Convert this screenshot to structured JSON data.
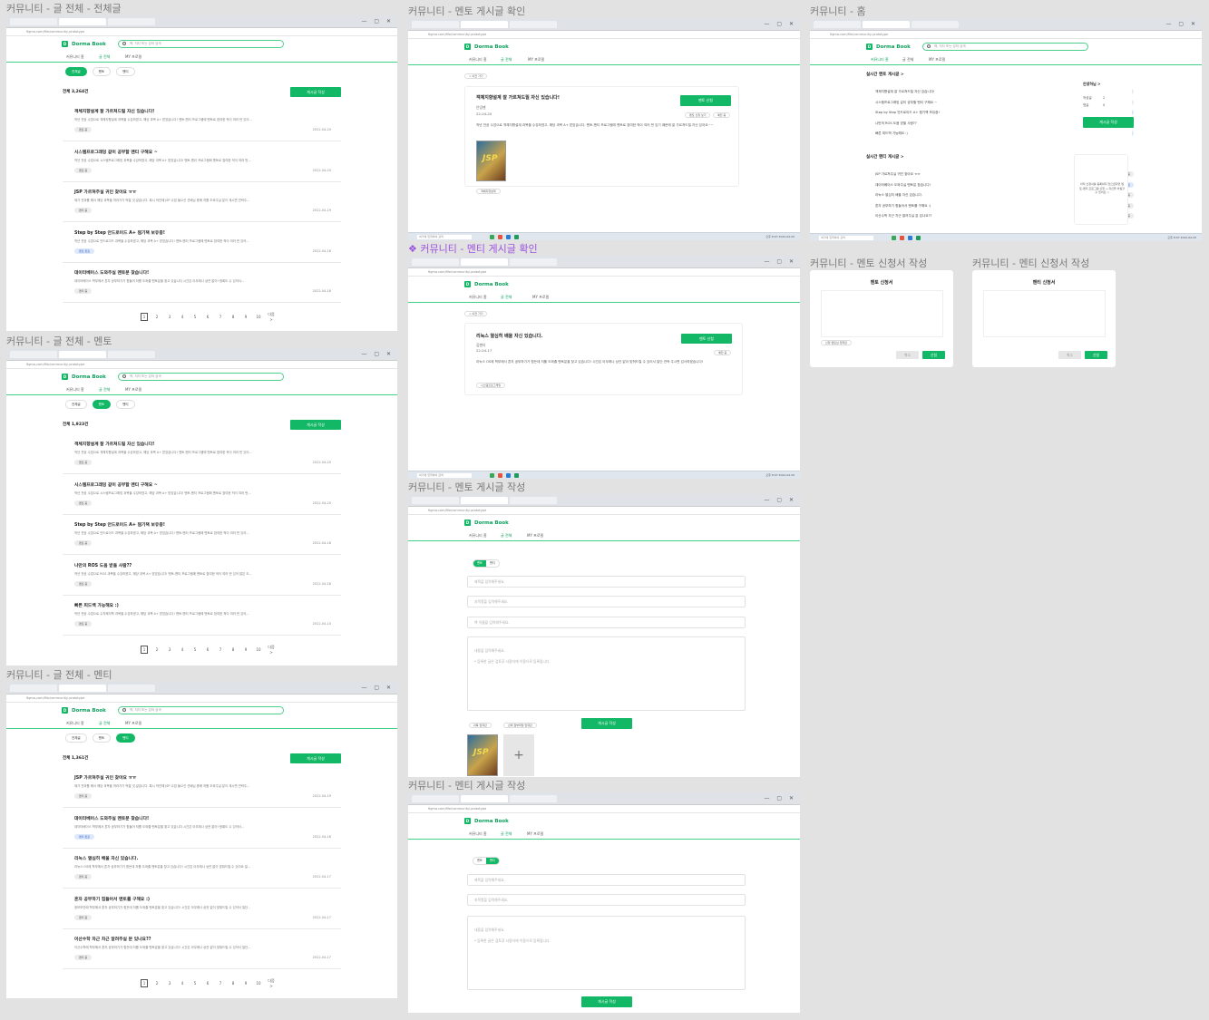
{
  "brand": "Dorma Book",
  "browser_tab": "커뮤니티 - Figma",
  "address": "figma.com/file/community-prototype",
  "nav": [
    "커뮤니티 홈",
    "글 전체",
    "MY 프로필"
  ],
  "search_placeholder": "책, 저자 또는 강좌 검색",
  "filters": [
    "전체글",
    "멘토",
    "멘티"
  ],
  "write_label": "게시글 작성",
  "next_label": "다음 >",
  "pages": [
    "1",
    "2",
    "3",
    "4",
    "5",
    "6",
    "7",
    "8",
    "9",
    "10"
  ],
  "taskbar_search": "여기에 입력하여 검색",
  "taskbar_time": "오후 8:07 2022-04-20",
  "frames": {
    "all": {
      "title": "커뮤니티 - 글 전체 - 전체글",
      "count": "전체 3,264건",
      "posts": [
        {
          "title": "객체지향설계 잘 가르쳐드릴 자신 있습니다!",
          "desc": "작년 전공 수업으로 객체지향설계 과목을 수강하였고, 해당 과목 A+ 받았습니다! 멘토-멘티 프로그램에 멘토로 참여한 적이 여러 번 있어...",
          "tag": "멘토 중",
          "tag_blue": false,
          "date": "2022-04-20"
        },
        {
          "title": "시스템프로그래밍 같이 공부할 멘티 구해요 ~",
          "desc": "작년 전공 수업으로 시스템프로그래밍 과목을 수강하였고, 해당 과목 A+ 받았습니다! 멘토-멘티 프로그램에 멘토로 참여한 적이 여러 번...",
          "tag": "멘토 중",
          "tag_blue": false,
          "date": "2022-04-20"
        },
        {
          "title": "JSP 가르쳐주실 귀인 찾아요 ㅠㅠ",
          "desc": "제가 전과를 해서 해당 과목을 따라가기 벅찰 것 같습니다. 혹시 작년에 JSP 수업 들으신 선배님 중에 저를 도와주실 분이 계시면 연락주...",
          "tag": "멘티 중",
          "tag_blue": false,
          "date": "2022-04-19"
        },
        {
          "title": "Step by Step 안드로이드 A+ 찜기책 보유중!",
          "desc": "작년 전공 수업으로 안드로이드 과목을 수강하였고, 해당 과목 A+ 받았습니다! 멘토-멘티 프로그램에 멘토로 참여한 적이 여러 번 있어...",
          "tag": "멘토 완료",
          "tag_blue": true,
          "date": "2022-04-18"
        },
        {
          "title": "데이터베이스 도와주실 멘토분 찾습니다!",
          "desc": "데이터베이스 학부에서 혼자 공부하기가 힘들어 저를 도와줄 멘토분을 찾고 있습니다 시간은 아무래나 상관 없어! 링회도 수 있어서...",
          "tag": "멘티 중",
          "tag_blue": false,
          "date": "2022-04-18"
        }
      ]
    },
    "mentor": {
      "title": "커뮤니티 - 글 전체 - 멘토",
      "count": "전체 1,923건",
      "posts": [
        {
          "title": "객체지향설계 잘 가르쳐드릴 자신 있습니다!",
          "desc": "작년 전공 수업으로 객체지향설계 과목을 수강하였고, 해당 과목 A+ 받았습니다! 멘토-멘티 프로그램에 멘토로 참여한 적이 여러 번 있어...",
          "tag": "멘토 중",
          "tag_blue": false,
          "date": "2022-04-20"
        },
        {
          "title": "시스템프로그래밍 같이 공부할 멘티 구해요 ~",
          "desc": "작년 전공 수업으로 시스템프로그래밍 과목을 수강하였고, 해당 과목 A+ 받았습니다! 멘토-멘티 프로그램에 멘토로 참여한 적이 여러 번...",
          "tag": "멘토 중",
          "tag_blue": false,
          "date": "2022-04-20"
        },
        {
          "title": "Step by Step 안드로이드 A+ 찜기책 보유중!",
          "desc": "작년 전공 수업으로 안드로이드 과목을 수강하였고, 해당 과목 A+ 받았습니다! 멘토-멘티 프로그램에 멘토로 참여한 적이 여러 번 있어...",
          "tag": "멘토 중",
          "tag_blue": false,
          "date": "2022-04-18"
        },
        {
          "title": "나만의 ROS 도움 받을 사람??",
          "desc": "작년 전공 수업으로 ROS 과목을 수강하였고, 해당 과목 A+ 받았습니다! 멘토-멘티 프로그램에 멘토로 참여한 적이 여러 번 있어 많은 도...",
          "tag": "멘토 중",
          "tag_blue": false,
          "date": "2022-04-18"
        },
        {
          "title": "빠른 피드백 가능해요 :)",
          "desc": "작년 전공 수업으로 수치해석학 과목을 수강하였고, 해당 과목 A+ 받았습니다! 멘토-멘티 프로그램에 멘토로 참여한 적이 여러 번 있어...",
          "tag": "멘토 중",
          "tag_blue": false,
          "date": "2022-04-10"
        }
      ]
    },
    "mentee": {
      "title": "커뮤니티 - 글 전체 - 멘티",
      "count": "전체 1,361건",
      "posts": [
        {
          "title": "JSP 가르쳐주실 귀인 찾아요 ㅠㅠ",
          "desc": "제가 전과를 해서 해당 과목을 따라가기 벅찰 것 같습니다. 혹시 작년에 JSP 수업 들으신 선배님 중에 저를 도와주실 분이 계시면 연락주...",
          "tag": "멘티 중",
          "tag_blue": false,
          "date": "2022-04-19"
        },
        {
          "title": "데이터베이스 도와주실 멘토분 찾습니다!",
          "desc": "데이터베이스 학부에서 혼자 공부하기가 힘들어 저를 도와줄 멘토분을 찾고 있습니다 시간은 아무래나 상관 없어! 링회도 수 있어서...",
          "tag": "멘티 완료",
          "tag_blue": true,
          "date": "2022-04-18"
        },
        {
          "title": "리눅스 열심히 배울 자신 있습니다.",
          "desc": "리눅스 OS에 학부에서 혼자 공부하기가 힘든데 저를 도와줄 멘토분을 찾고 있습니다! 시간은 아무래나 상관 없이 맞춰드릴 수 있어요 일...",
          "tag": "멘티 중",
          "tag_blue": false,
          "date": "2022-04-17"
        },
        {
          "title": "혼자 공부하기 힘들어서 멘토를 구해요 :)",
          "desc": "정보보안에 학부에서 혼자 공부하기가 힘든데 저를 도와줄 멘토분을 찾고 있습니다! 시간은 아무래나 상관 없이 맞춰드릴 수 있어서 일단...",
          "tag": "멘티 중",
          "tag_blue": false,
          "date": "2022-04-17"
        },
        {
          "title": "이산수학 차근 차근 알려주실 분 있나요??",
          "desc": "이산수학에 학부에서 혼자 공부하기가 힘든데 저를 도와줄 멘토분을 찾고 있습니다! 시간은 아무래나 상관 없이 맞춰드릴 수 있어서 일단...",
          "tag": "멘티 중",
          "tag_blue": false,
          "date": "2022-04-17"
        }
      ]
    },
    "mentor_view": {
      "title": "커뮤니티 - 멘토 게시글 확인",
      "back": "< 이전 가기",
      "post_title": "객체지향설계 잘 가르쳐드릴 자신 있습니다!",
      "author": "안녕맨",
      "date": "22-04-20",
      "apply": "멘토 신청",
      "tags": [
        "멘토 신청 보기",
        "예전 중"
      ],
      "body": "작년 전공 수업으로 객체지향설계 과목을 수강하였고, 해당 과목 A+ 받았습니다. 멘토-멘티 프로그램에 멘토로 참여한 적이 여러 번 있기 때문에 잘 가르쳐드릴 자신 있어요~~",
      "subject_tag": "객체지향설계"
    },
    "mentee_view": {
      "title": "커뮤니티 - 멘티 게시글 확인",
      "back": "< 이전 가기",
      "post_title": "리눅스 열심히 배울 자신 있습니다.",
      "author": "김멘티",
      "date": "22-04-17",
      "apply": "멘토 신청",
      "tag": "예전 중",
      "body": "리눅스 OS에 학부에서 혼자 공부하기가 힘든데 저를 도와줄 멘토분을 찾고 있습니다! 시간은 아무래나 상관 없이 맞춰드릴 수 있어서 일단 연락 주시면 감사하겠습니다!",
      "subject_tag": "시스템프로그래밍"
    },
    "mentor_write": {
      "title": "커뮤니티 - 멘토 게시글 작성",
      "toggle": [
        "멘토",
        "멘티"
      ],
      "ph_title": "제목을 입력해주세요.",
      "ph_subject": "과목명을 입력해주세요.",
      "ph_book": "책 이름을 입력해주세요.",
      "ph_body": "내용을 입력해주세요.",
      "ph_body_note": "* 등록한 글은 검토후 사용자에 이용으로 등록됩니다.",
      "tag_a": "과목 입력란",
      "tag_b": "선택 첨부파일 입력란",
      "submit": "게시글 작성",
      "book_label": "JSP",
      "plus": "+"
    },
    "mentee_write": {
      "title": "커뮤니티 - 멘티 게시글 작성",
      "toggle": [
        "멘토",
        "멘티"
      ],
      "ph_title": "제목을 입력해주세요.",
      "ph_subject": "과목명을 입력해주세요.",
      "ph_body": "내용을 입력해주세요.",
      "ph_body_note": "* 등록한 글은 검토후 사용자에 이용으로 등록됩니다.",
      "submit": "게시글 작성"
    },
    "home": {
      "title": "커뮤니티 - 홈",
      "mentor_head": "실시간 멘토 게시글 >",
      "mentee_head": "실시간 멘티 게시글 >",
      "mentor_rows": [
        {
          "t": "객체지향설계 잘 가르쳐드릴 자신 있습니다!",
          "b": "멘토 중",
          "blue": false
        },
        {
          "t": "시스템프로그래밍 같이 공부할 멘티 구해요 ~",
          "b": "멘토 중",
          "blue": false
        },
        {
          "t": "Step by Step 안드로이드 A+ 찜기책 보유중!",
          "b": "멘토 완료",
          "blue": true
        },
        {
          "t": "나만의 ROS 도움 받을 사람??",
          "b": "멘토 중",
          "blue": false
        },
        {
          "t": "빠른 피드백 가능해요 :)",
          "b": "멘토 완료",
          "blue": true
        }
      ],
      "mentee_rows": [
        {
          "t": "JSP 가르쳐주실 귀인 찾아요 ㅠㅠ",
          "b": "멘티 중",
          "blue": false
        },
        {
          "t": "데이터베이스 도와주실 멘토분 찾습니다!",
          "b": "멘티 완료",
          "blue": true
        },
        {
          "t": "리눅스 열심히 배울 자신 있습니다.",
          "b": "멘티 중",
          "blue": false
        },
        {
          "t": "혼자 공부하기 힘들어서 멘토를 구해요 :)",
          "b": "멘티 중",
          "blue": false
        },
        {
          "t": "이산수학 차근 차근 알려주실 분 있나요??",
          "b": "멘티 중",
          "blue": false
        }
      ],
      "side_title": "안녕하님 >",
      "side_k1": "작성글",
      "side_v1": "2",
      "side_k2": "댓글",
      "side_v2": "0",
      "side_btn": "게시글 작성",
      "notice": "아직 신청서를 등록하지 않으셨다면 멘토-멘티 프로그램 신청 → 자신을 어필할 수 있어요 :)"
    },
    "mentor_apply": {
      "title": "커뮤니티 - 멘토 신청서 작성",
      "heading": "멘토 신청서",
      "field": "신청 멘토님 입력란",
      "cancel": "취소",
      "submit": "신청"
    },
    "mentee_apply": {
      "title": "커뮤니티 - 멘티 신청서 작성",
      "heading": "멘티 신청서",
      "cancel": "취소",
      "submit": "신청"
    }
  }
}
